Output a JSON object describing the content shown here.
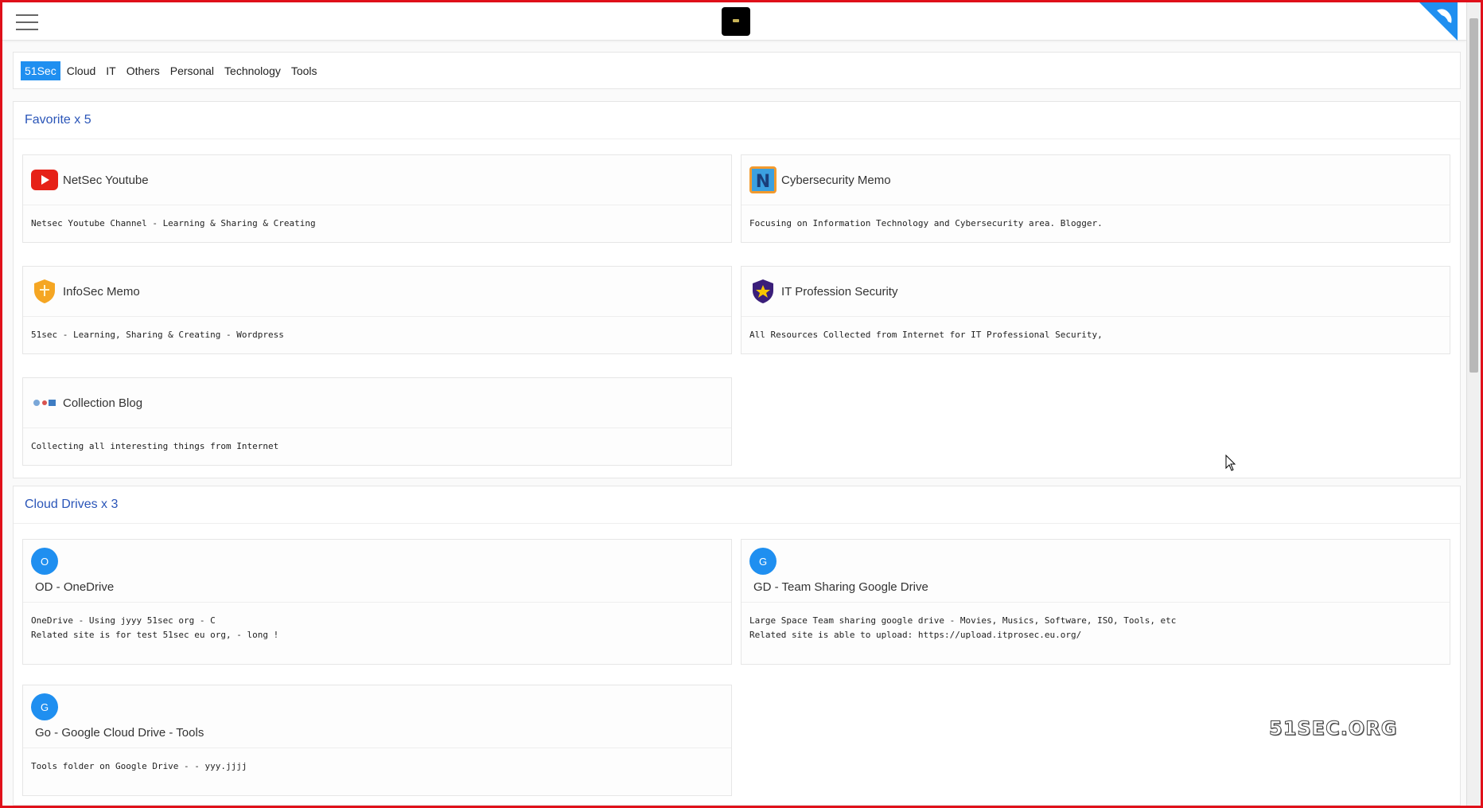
{
  "header": {
    "menu_icon": "hamburger-icon",
    "logo_icon": "site-logo"
  },
  "tabs": [
    {
      "label": "51Sec",
      "active": true
    },
    {
      "label": "Cloud"
    },
    {
      "label": "IT"
    },
    {
      "label": "Others"
    },
    {
      "label": "Personal"
    },
    {
      "label": "Technology"
    },
    {
      "label": "Tools"
    }
  ],
  "favorite": {
    "title": "Favorite x 5",
    "cards": [
      {
        "title": "NetSec Youtube",
        "desc": "Netsec Youtube Channel - Learning & Sharing & Creating",
        "icon": "youtube-icon"
      },
      {
        "title": "Cybersecurity Memo",
        "desc": "Focusing on Information Technology and Cybersecurity area. Blogger.",
        "icon": "n-logo-icon"
      },
      {
        "title": "InfoSec Memo",
        "desc": "51sec - Learning, Sharing & Creating - Wordpress",
        "icon": "shield-icon"
      },
      {
        "title": "IT Profession Security",
        "desc": "All Resources Collected from Internet for IT Professional Security,",
        "icon": "star-shield-icon"
      },
      {
        "title": "Collection Blog",
        "desc": "Collecting all interesting things from Internet",
        "icon": "collection-icon"
      }
    ]
  },
  "cloud": {
    "title": "Cloud Drives x 3",
    "cards": [
      {
        "letter": "O",
        "title": "OD - OneDrive",
        "desc": "OneDrive - Using jyyy 51sec org  - C\nRelated site is for test 51sec eu org, - long !"
      },
      {
        "letter": "G",
        "title": "GD - Team Sharing Google Drive",
        "desc": "Large Space Team sharing google drive - Movies, Musics, Software, ISO, Tools, etc\nRelated site is able to upload: https://upload.itprosec.eu.org/"
      },
      {
        "letter": "G",
        "title": "Go - Google Cloud Drive - Tools",
        "desc": "Tools folder on Google Drive -  - yyy.jjjj"
      }
    ]
  },
  "watermark": "51SEC.ORG",
  "colors": {
    "accent": "#1f8ff0",
    "section_title": "#2a55b8",
    "frame": "#e0101a"
  }
}
